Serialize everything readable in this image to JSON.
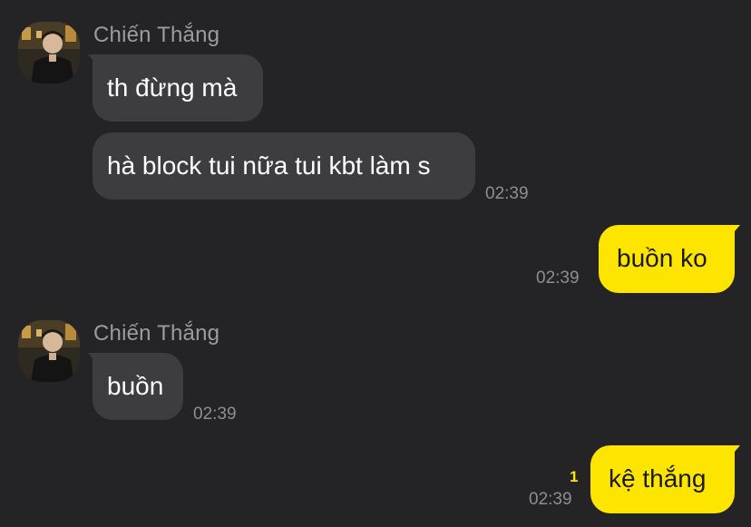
{
  "contact": {
    "name": "Chiến Thắng"
  },
  "messages": [
    {
      "direction": "in",
      "text": "th đừng mà"
    },
    {
      "direction": "in",
      "text": "hà block tui nữa tui kbt làm s",
      "time": "02:39"
    },
    {
      "direction": "out",
      "text": "buồn ko",
      "time": "02:39"
    },
    {
      "direction": "in",
      "text": "buồn",
      "time": "02:39"
    },
    {
      "direction": "out",
      "text": "kệ thắng",
      "time": "02:39",
      "unread_count": "1"
    }
  ],
  "colors": {
    "background": "#242426",
    "incoming_bubble": "#3d3d3f",
    "outgoing_bubble": "#fee500",
    "unread_accent": "#fee500"
  }
}
